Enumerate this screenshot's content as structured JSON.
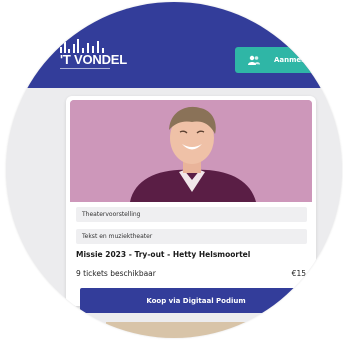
{
  "header": {
    "logo_text": "'T VONDEL",
    "login_label": "Aanmelden"
  },
  "event": {
    "tags": [
      "Theatervoorstelling",
      "Tekst en muziektheater"
    ],
    "title": "Missie 2023 - Try-out - Hetty Helsmoortel",
    "tickets": "9 tickets beschikbaar",
    "price": "€15",
    "buy_label": "Koop via Digitaal Podium"
  },
  "colors": {
    "brand_blue": "#333d9a",
    "accent_teal": "#2fb6a6",
    "photo_background": "#cd97ba"
  },
  "icons": [
    "logo-wave-icon",
    "user-icon"
  ]
}
